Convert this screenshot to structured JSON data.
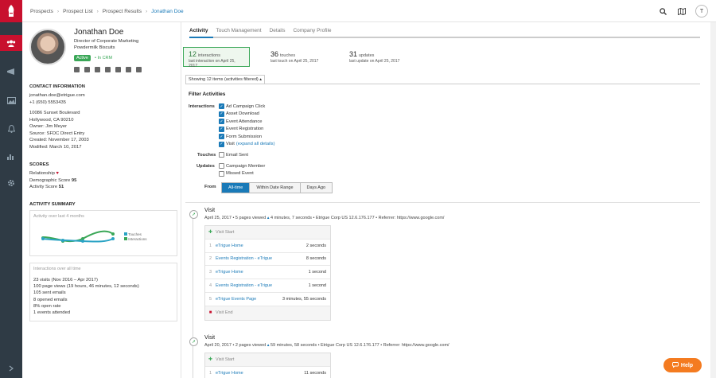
{
  "breadcrumb": [
    "Prospects",
    "Prospect List",
    "Prospect Results",
    "Jonathan Doe"
  ],
  "user_initial": "T",
  "profile": {
    "name": "Jonathan Doe",
    "title": "Director of Corporate Marketing",
    "company": "Powdermilk Biscuits",
    "status": "Active",
    "crm": "• In CRM"
  },
  "contact": {
    "heading": "CONTACT INFORMATION",
    "email": "jonathan.doe@etrigue.com",
    "phone": "+1 (650) 5553435",
    "address1": "10086 Sunset Boulevard",
    "address2": "Hollywood, CA 90210",
    "owner": "Owner: Jim Meyer",
    "source": "Source: SFDC Direct Entry",
    "created": "Created: November 17, 2003",
    "modified": "Modified: March 10, 2017"
  },
  "scores": {
    "heading": "SCORES",
    "relationship": "Relationship",
    "demographic_label": "Demographic Score",
    "demographic_value": "95",
    "activity_label": "Activity Score",
    "activity_value": "51"
  },
  "summary": {
    "heading": "ACTIVITY SUMMARY",
    "chart_title": "Activity over last 4 months",
    "legend_touches": "Touches",
    "legend_interactions": "Interactions",
    "all_time_title": "Interactions over all time",
    "lines": [
      "23 visits (Nov 2016 – Apr 2017)",
      "100 page views (19 hours, 46 minutes, 12 seconds)",
      "105 sent emails",
      "8 opened emails",
      "8% open rate",
      "1 events attended"
    ]
  },
  "tabs": [
    "Activity",
    "Touch Management",
    "Details",
    "Company Profile"
  ],
  "stats": [
    {
      "num": "12",
      "label": "interactions",
      "sub": "last interaction on April 25, 2017"
    },
    {
      "num": "36",
      "label": "touches",
      "sub": "last touch on April 25, 2017"
    },
    {
      "num": "31",
      "label": "updates",
      "sub": "last update on April 25, 2017"
    }
  ],
  "showing": "Showing 12 items (activities filtered) ▴",
  "filter": {
    "title": "Filter Activities",
    "interactions_label": "Interactions",
    "interactions": [
      "Ad Campaign Click",
      "Asset Download",
      "Event Attendance",
      "Event Registration",
      "Form Submission",
      "Visit"
    ],
    "expand_link": "(expand all details)",
    "touches_label": "Touches",
    "touches": [
      "Email Sent"
    ],
    "updates_label": "Updates",
    "updates": [
      "Campaign Member",
      "Missed Event"
    ],
    "from_label": "From",
    "ranges": [
      "All-time",
      "Within Date Range",
      "Days Ago"
    ]
  },
  "visits": [
    {
      "title": "Visit",
      "meta_pre": "April 25, 2017 • 5 pages viewed",
      "meta_post": "4 minutes, 7 seconds • Etrigue Corp US 12.6.176.177 • Referrer: https://www.google.com/",
      "start": "Visit Start",
      "end": "Visit End",
      "rows": [
        {
          "i": "1",
          "page": "eTrigue Home",
          "dur": "2 seconds"
        },
        {
          "i": "2",
          "page": "Events Registration - eTrigue",
          "dur": "8 seconds"
        },
        {
          "i": "3",
          "page": "eTrigue Home",
          "dur": "1 second"
        },
        {
          "i": "4",
          "page": "Events Registration - eTrigue",
          "dur": "1 second"
        },
        {
          "i": "5",
          "page": "eTrigue Events Page",
          "dur": "3 minutes, 55 seconds"
        }
      ]
    },
    {
      "title": "Visit",
      "meta_pre": "April 20, 2017 • 2 pages viewed",
      "meta_post": "59 minutes, 58 seconds • Etrigue Corp US 12.6.176.177 • Referrer: https://www.google.com/",
      "start": "Visit Start",
      "rows": [
        {
          "i": "1",
          "page": "eTrigue Home",
          "dur": "11 seconds"
        }
      ]
    }
  ],
  "help_label": "Help",
  "colors": {
    "accent": "#1a7ab8",
    "brand": "#c8102e",
    "success": "#3aa757",
    "help": "#f47b20",
    "rail": "#2f3b45"
  }
}
